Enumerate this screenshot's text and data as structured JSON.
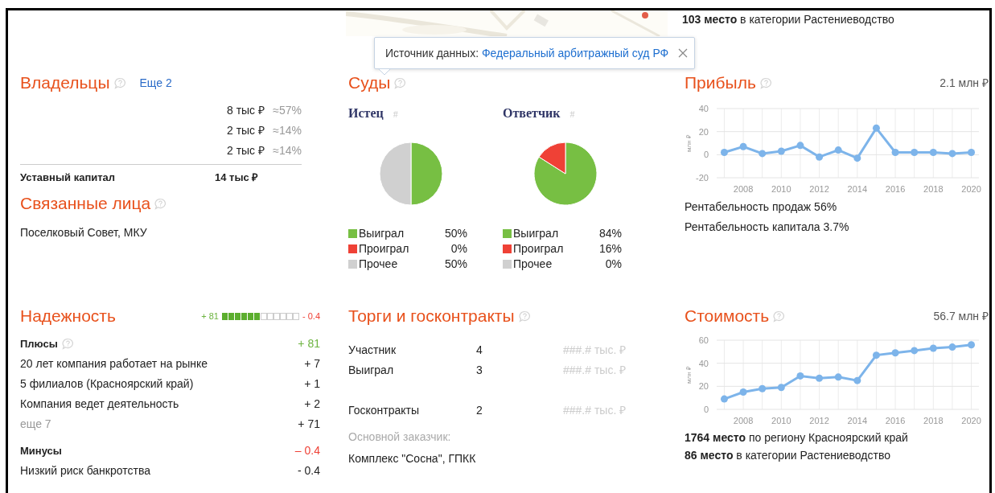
{
  "top": {
    "rank": "**103 место** в категории Растениеводство"
  },
  "tooltip": {
    "label": "Источник данных:",
    "link": "Федеральный арбитражный суд РФ"
  },
  "owners": {
    "title": "Владельцы",
    "more": "Еще 2",
    "rows": [
      {
        "amount": "8 тыс ₽",
        "share": "≈57%"
      },
      {
        "amount": "2 тыс ₽",
        "share": "≈14%"
      },
      {
        "amount": "2 тыс ₽",
        "share": "≈14%"
      }
    ],
    "capital_label": "Уставный капитал",
    "capital_value": "14 тыс ₽"
  },
  "related": {
    "title": "Связанные лица",
    "text": "Поселковый Совет, МКУ"
  },
  "courts": {
    "title": "Суды",
    "parties": [
      {
        "title": "Истец",
        "hash": "#",
        "chart_data": {
          "type": "pie",
          "categories": [
            "Выиграл",
            "Проиграл",
            "Прочее"
          ],
          "values": [
            50,
            0,
            50
          ],
          "colors": [
            "#77bf43",
            "#ef4136",
            "#d0d0d0"
          ]
        },
        "legend_values": [
          "50%",
          "0%",
          "50%"
        ]
      },
      {
        "title": "Ответчик",
        "hash": "#",
        "chart_data": {
          "type": "pie",
          "categories": [
            "Выиграл",
            "Проиграл",
            "Прочее"
          ],
          "values": [
            84,
            16,
            0
          ],
          "colors": [
            "#77bf43",
            "#ef4136",
            "#d0d0d0"
          ]
        },
        "legend_values": [
          "84%",
          "16%",
          "0%"
        ]
      }
    ]
  },
  "profit": {
    "title": "Прибыль",
    "value": "2.1 млн ₽",
    "chart_data": {
      "type": "line",
      "ylabel": "млн ₽",
      "x": [
        2007,
        2008,
        2009,
        2010,
        2011,
        2012,
        2013,
        2014,
        2015,
        2016,
        2017,
        2018,
        2019,
        2020
      ],
      "series": [
        {
          "color": "#7db4ea",
          "marker": "circle",
          "values": [
            2,
            7,
            1,
            3,
            8,
            -2,
            4,
            -3,
            23,
            2,
            2,
            2,
            1,
            2
          ]
        }
      ],
      "xlim": [
        2006.6,
        2020.4
      ],
      "ylim": [
        -20,
        40
      ],
      "yticks": [
        -20,
        0,
        20,
        40
      ],
      "xticks": [
        2008,
        2010,
        2012,
        2014,
        2016,
        2018,
        2020
      ],
      "grid": true
    },
    "lines": [
      "Рентабельность продаж 56%",
      "Рентабельность капитала 3.7%"
    ]
  },
  "reliability": {
    "title": "Надежность",
    "plus_total": "+ 81",
    "minus_total": "- 0.4",
    "level": 0.5,
    "groups": [
      {
        "kind": "plus",
        "title": "Плюсы",
        "help": true,
        "total": "+ 81",
        "items": [
          {
            "label": "20 лет компания работает на рынке",
            "value": "+ 7",
            "muted": false
          },
          {
            "label": "5 филиалов (Красноярский край)",
            "value": "+ 1",
            "muted": false
          },
          {
            "label": "Компания ведет деятельность",
            "value": "+ 2",
            "muted": false
          },
          {
            "label": "еще 7",
            "value": "+ 71",
            "muted": true
          }
        ]
      },
      {
        "kind": "minus",
        "title": "Минусы",
        "help": false,
        "total": "– 0.4",
        "items": [
          {
            "label": "Низкий риск банкротства",
            "value": "- 0.4",
            "muted": false
          }
        ]
      }
    ]
  },
  "tenders": {
    "title": "Торги и госконтракты",
    "rows": [
      {
        "label": "Участник",
        "count": "4",
        "amount": "###.# тыс. ₽"
      },
      {
        "label": "Выиграл",
        "count": "3",
        "amount": "###.# тыс. ₽"
      }
    ],
    "contracts": [
      {
        "label": "Госконтракты",
        "count": "2",
        "amount": "###.# тыс. ₽"
      }
    ],
    "customer_label": "Основной заказчик:",
    "customer": "Комплекс \"Сосна\", ГПКК"
  },
  "value": {
    "title": "Стоимость",
    "value": "56.7 млн ₽",
    "chart_data": {
      "type": "line",
      "ylabel": "млн ₽",
      "x": [
        2007,
        2008,
        2009,
        2010,
        2011,
        2012,
        2013,
        2014,
        2015,
        2016,
        2017,
        2018,
        2019,
        2020
      ],
      "series": [
        {
          "color": "#7db4ea",
          "marker": "circle",
          "values": [
            9,
            15,
            18,
            19,
            29,
            27,
            28,
            25,
            47,
            49,
            51,
            53,
            54,
            56
          ]
        }
      ],
      "xlim": [
        2006.6,
        2020.4
      ],
      "ylim": [
        0,
        60
      ],
      "yticks": [
        0,
        20,
        40,
        60
      ],
      "xticks": [
        2008,
        2010,
        2012,
        2014,
        2016,
        2018,
        2020
      ],
      "grid": true
    },
    "lines": [
      "**1764 место** по региону Красноярский край",
      "**86 место** в категории Растениеводство"
    ]
  }
}
